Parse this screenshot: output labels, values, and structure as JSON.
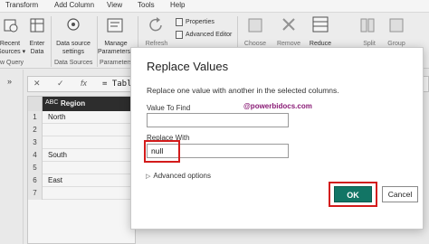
{
  "menu": {
    "items": [
      "Transform",
      "Add Column",
      "View",
      "Tools",
      "Help"
    ]
  },
  "ribbon": {
    "recent_sources": "Recent\nSources ▾",
    "enter_data": "Enter\nData",
    "data_source_settings": "Data source\nsettings",
    "manage_parameters": "Manage\nParameters ▾",
    "refresh": "Refresh",
    "properties": "Properties",
    "advanced_editor": "Advanced Editor",
    "choose": "Choose",
    "remove": "Remove",
    "reduce": "Reduce",
    "split": "Split",
    "group": "Group",
    "group_new_query": "w Query",
    "group_data_sources": "Data Sources",
    "group_parameters": "Parameters"
  },
  "left_pane": {
    "collapse_glyph": "»"
  },
  "formula_bar": {
    "cancel": "✕",
    "confirm": "✓",
    "fx": "fx",
    "formula": "= Table"
  },
  "grid": {
    "column_type": "ABC",
    "column_name": "Region",
    "rows": [
      {
        "num": "1",
        "value": "North"
      },
      {
        "num": "2",
        "value": ""
      },
      {
        "num": "3",
        "value": ""
      },
      {
        "num": "4",
        "value": "South"
      },
      {
        "num": "5",
        "value": ""
      },
      {
        "num": "6",
        "value": "East"
      },
      {
        "num": "7",
        "value": ""
      }
    ]
  },
  "dialog": {
    "title": "Replace Values",
    "description": "Replace one value with another in the selected columns.",
    "value_to_find_label": "Value To Find",
    "value_to_find": "",
    "replace_with_label": "Replace With",
    "replace_with": "null",
    "watermark": "@powerbidocs.com",
    "advanced_options": "Advanced options",
    "ok_label": "OK",
    "cancel_label": "Cancel"
  },
  "colors": {
    "ok_button": "#127565",
    "highlight": "#d31b1b",
    "watermark": "#8a1b76",
    "grid_header": "#2f2f2f"
  }
}
